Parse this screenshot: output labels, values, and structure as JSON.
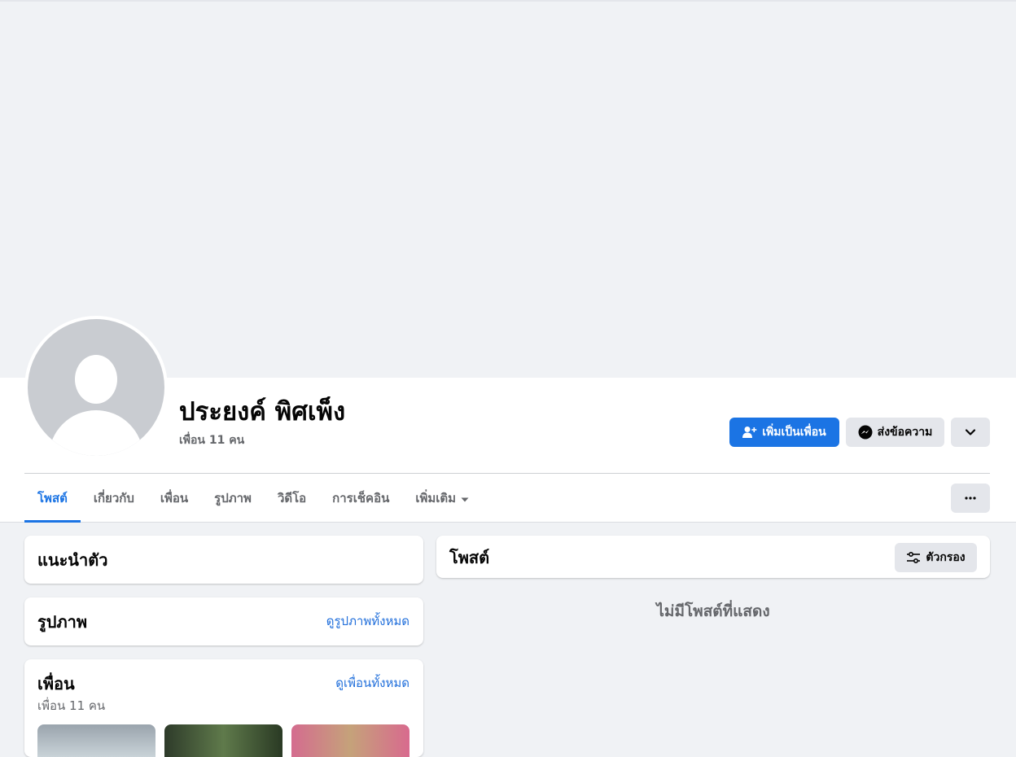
{
  "profile": {
    "name": "ประยงค์ พิศเพ็ง",
    "friend_count": "เพื่อน 11 คน"
  },
  "actions": {
    "add_friend": "เพิ่มเป็นเพื่อน",
    "message": "ส่งข้อความ"
  },
  "tabs": [
    {
      "label": "โพสต์",
      "active": true
    },
    {
      "label": "เกี่ยวกับ"
    },
    {
      "label": "เพื่อน"
    },
    {
      "label": "รูปภาพ"
    },
    {
      "label": "วิดีโอ"
    },
    {
      "label": "การเช็คอิน"
    },
    {
      "label": "เพิ่มเติม"
    }
  ],
  "intro": {
    "title": "แนะนำตัว"
  },
  "photos": {
    "title": "รูปภาพ",
    "see_all": "ดูรูปภาพทั้งหมด"
  },
  "friends": {
    "title": "เพื่อน",
    "see_all": "ดูเพื่อนทั้งหมด",
    "count": "เพื่อน 11 คน"
  },
  "posts": {
    "title": "โพสต์",
    "filter": "ตัวกรอง",
    "empty": "ไม่มีโพสต์ที่แสดง"
  },
  "colors": {
    "accent": "#1b74e4",
    "link": "#216fdb",
    "muted": "#65676b",
    "page_bg": "#f0f2f5"
  },
  "icons": [
    "add-friend-icon",
    "messenger-icon",
    "chevron-down-icon",
    "caret-down-icon",
    "more-icon",
    "filter-icon"
  ]
}
